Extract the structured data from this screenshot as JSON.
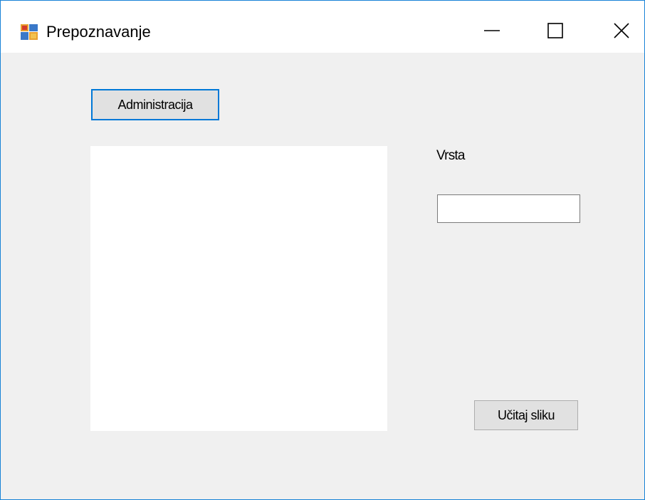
{
  "window": {
    "title": "Prepoznavanje",
    "icon": "winforms-app-icon",
    "controls": {
      "minimize": "minimize-icon",
      "maximize": "maximize-icon",
      "close": "close-icon"
    }
  },
  "form": {
    "admin_button_label": "Administracija",
    "vrsta_label": "Vrsta",
    "vrsta_value": "",
    "load_button_label": "Učitaj sliku"
  },
  "colors": {
    "form_background": "#f0f0f0",
    "titlebar_background": "#ffffff",
    "window_border": "#1883d7",
    "focus_border": "#0078d7",
    "button_face": "#e1e1e1",
    "button_border": "#adadad",
    "picture_box": "#ffffff"
  }
}
